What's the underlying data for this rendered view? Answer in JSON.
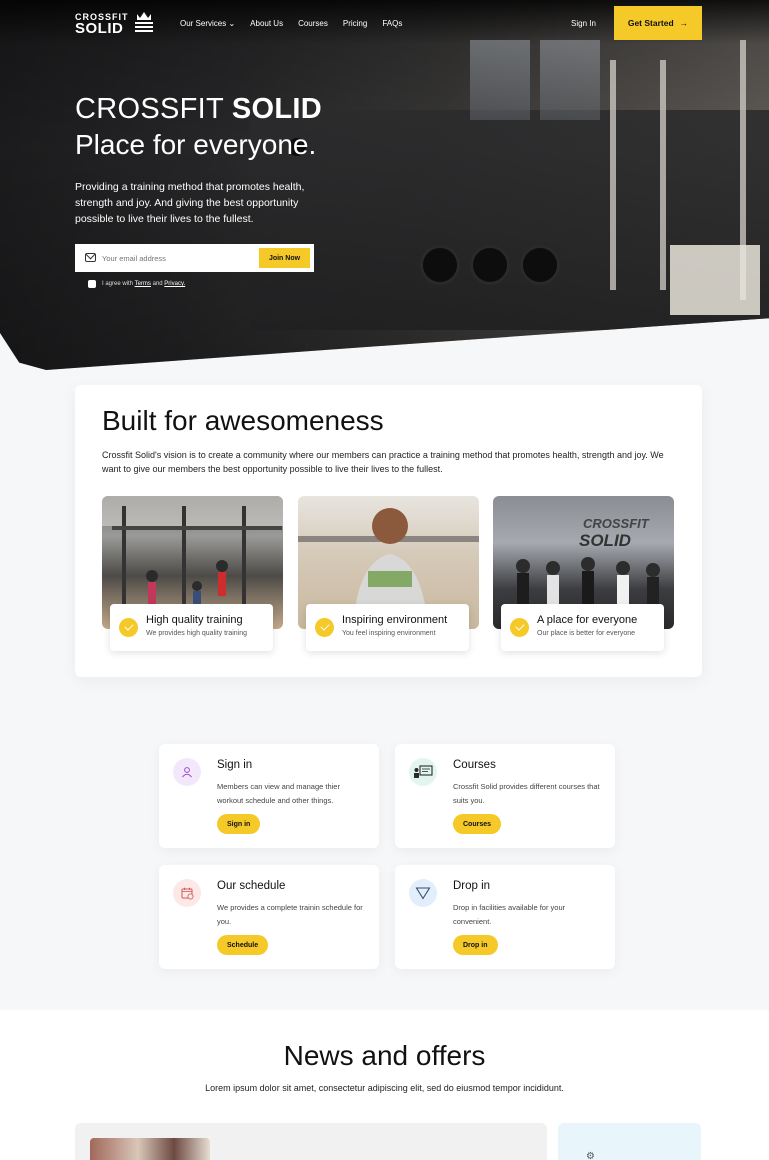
{
  "colors": {
    "accent": "#f5c928",
    "hero_dark": "#1d1d1f",
    "page_bg": "#f6f7f9"
  },
  "nav": {
    "logo_line1": "CROSSFIT",
    "logo_line2": "SOLID",
    "links": [
      "Our Services",
      "About Us",
      "Courses",
      "Pricing",
      "FAQs"
    ],
    "sign_in": "Sign In",
    "cta": "Get Started"
  },
  "hero": {
    "title_light": "CROSSFIT ",
    "title_bold": "SOLID",
    "subtitle": "Place for everyone.",
    "description": "Providing a training method that promotes health, strength and joy. And giving the best opportunity possible to live their lives to the fullest.",
    "email_placeholder": "Your email address",
    "join_label": "Join Now",
    "agree_prefix": "I agree with",
    "agree_terms": "Terms",
    "agree_and": "and",
    "agree_privacy": "Privacy."
  },
  "built": {
    "title": "Built for awesomeness",
    "text": "Crossfit Solid's vision is to create a community where our members can practice a training method that promotes health, strength and joy. We want to give our members the best opportunity possible to live their lives to the fullest.",
    "features": [
      {
        "title": "High quality training",
        "subtitle": "We provides high quality training"
      },
      {
        "title": "Inspiring environment",
        "subtitle": "You feel inspiring environment"
      },
      {
        "title": "A place for everyone",
        "subtitle": "Our place is better for everyone"
      }
    ],
    "image3_text": "CROSSFIT SOLID"
  },
  "services": [
    {
      "title": "Sign in",
      "desc": "Members can view and manage thier workout schedule and other things.",
      "button": "Sign in",
      "icon": "user-icon",
      "icon_bg": "#f3e8fb"
    },
    {
      "title": "Courses",
      "desc": "Crossfit Solid provides different courses that suits you.",
      "button": "Courses",
      "icon": "presentation-icon",
      "icon_bg": "#e2f5ef"
    },
    {
      "title": "Our schedule",
      "desc": "We provides a complete trainin schedule for you.",
      "button": "Schedule",
      "icon": "calendar-icon",
      "icon_bg": "#fde8e8"
    },
    {
      "title": "Drop in",
      "desc": "Drop in facilities available for your convenient.",
      "button": "Drop in",
      "icon": "triangle-icon",
      "icon_bg": "#e2eefb"
    }
  ],
  "news": {
    "title": "News and offers",
    "subtitle": "Lorem ipsum dolor sit amet, consectetur adipiscing elit, sed do eiusmod tempor incididunt."
  }
}
